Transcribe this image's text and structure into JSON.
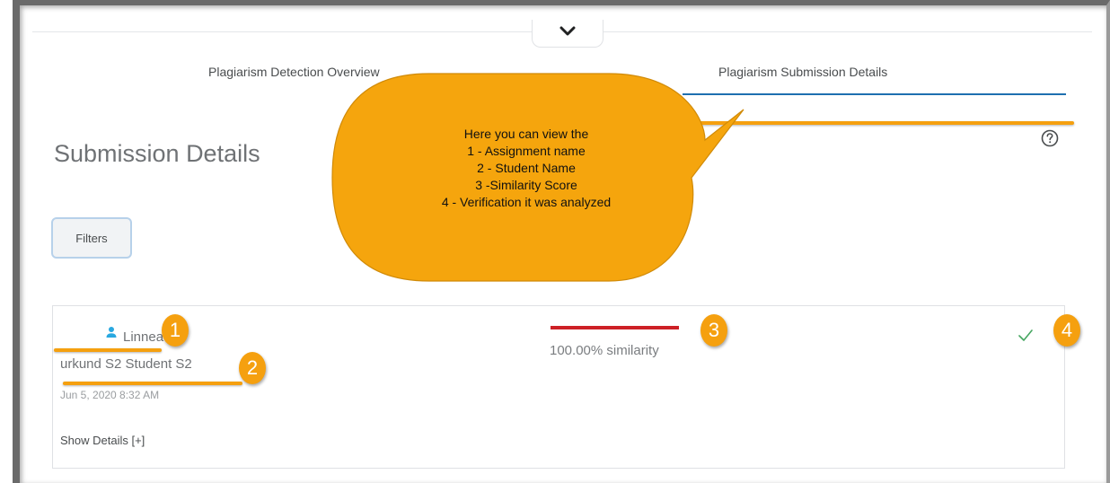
{
  "tabs": [
    {
      "label": "Plagiarism Detection Overview",
      "active": false
    },
    {
      "label": "Plagiarism Submission Details",
      "active": true
    }
  ],
  "page": {
    "title": "Submission Details"
  },
  "filters": {
    "label": "Filters"
  },
  "submission": {
    "user_name": "Linnea",
    "assignment": "urkund S2 Student S2",
    "date": "Jun 5, 2020 8:32 AM",
    "show_details": "Show Details [+]",
    "similarity_text": "100.00% similarity",
    "similarity_value": 100.0
  },
  "callout": {
    "lines": [
      "Here you can view the",
      "1 - Assignment name",
      "2 - Student Name",
      "3 -Similarity Score",
      "4 - Verification it was analyzed"
    ]
  },
  "markers": [
    "1",
    "2",
    "3",
    "4"
  ],
  "colors": {
    "accent_tab": "#1e6fb0",
    "similarity_bar": "#cd2026",
    "check": "#46a661",
    "annotation": "#f5a00f",
    "user_icon": "#29a8e0"
  },
  "icons": {
    "collapse": "chevron-down-icon",
    "help": "help-circle-icon",
    "user": "user-icon",
    "analyzed": "checkmark-icon"
  }
}
